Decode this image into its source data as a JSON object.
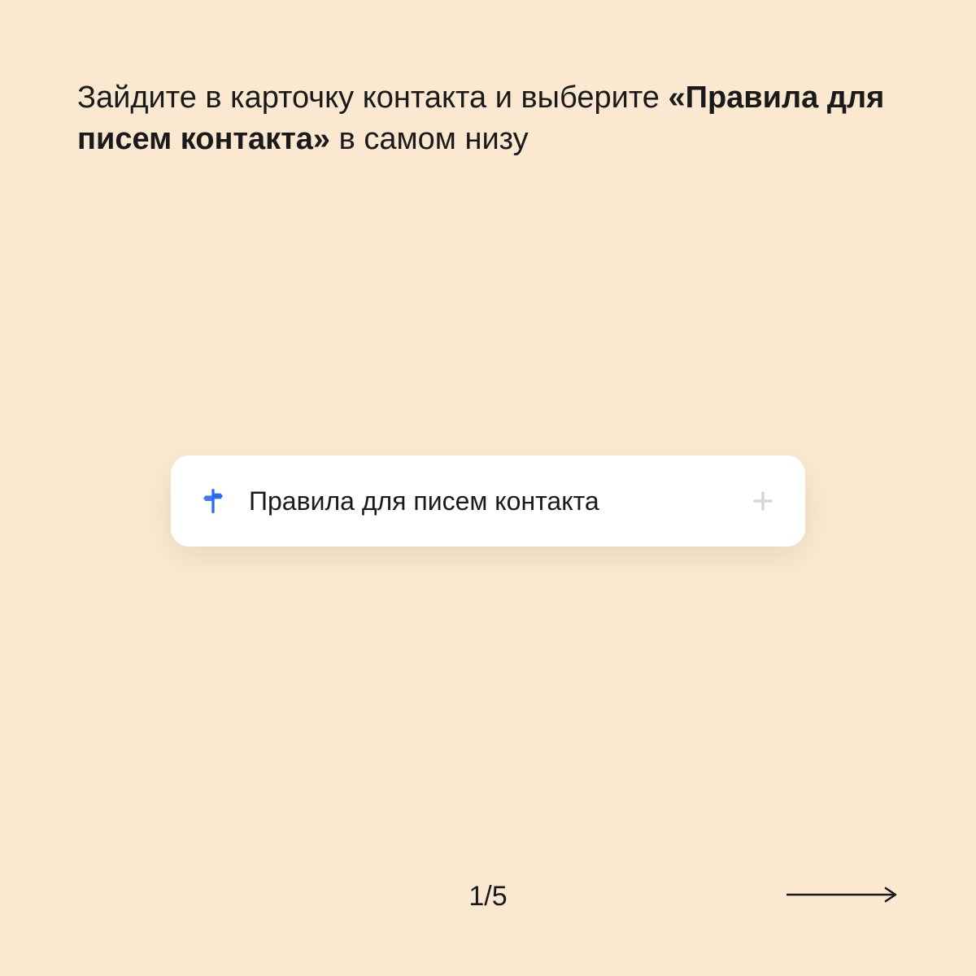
{
  "instruction": {
    "before": "Зайдите в карточку контакта и выберите ",
    "bold": "«Правила для писем контакта»",
    "after": " в самом низу"
  },
  "card": {
    "label": "Правила для писем контакта"
  },
  "pagination": {
    "current": "1",
    "separator": "/",
    "total": "5"
  },
  "colors": {
    "background": "#fbe8d0",
    "cardBg": "#ffffff",
    "text": "#1a1a1a",
    "iconBlue": "#2b6bf3",
    "plusGray": "#d6d6d6"
  }
}
